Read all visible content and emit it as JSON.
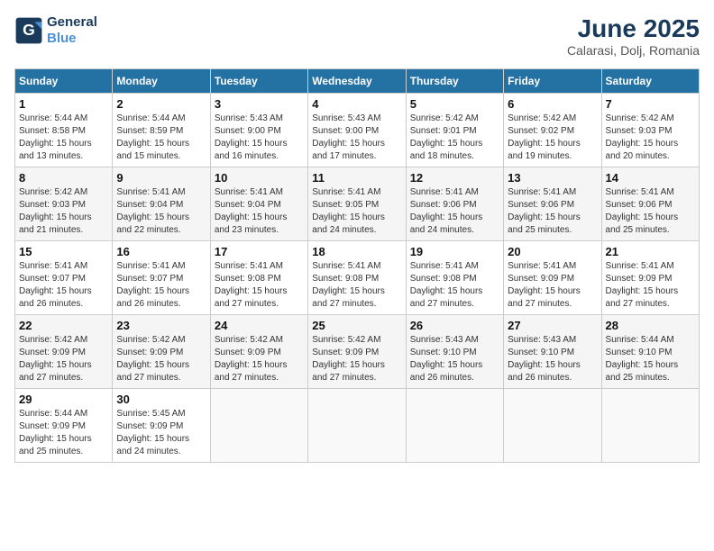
{
  "logo": {
    "line1": "General",
    "line2": "Blue"
  },
  "header": {
    "month_year": "June 2025",
    "location": "Calarasi, Dolj, Romania"
  },
  "days_of_week": [
    "Sunday",
    "Monday",
    "Tuesday",
    "Wednesday",
    "Thursday",
    "Friday",
    "Saturday"
  ],
  "weeks": [
    [
      {
        "day": "1",
        "sunrise": "5:44 AM",
        "sunset": "8:58 PM",
        "daylight": "15 hours and 13 minutes."
      },
      {
        "day": "2",
        "sunrise": "5:44 AM",
        "sunset": "8:59 PM",
        "daylight": "15 hours and 15 minutes."
      },
      {
        "day": "3",
        "sunrise": "5:43 AM",
        "sunset": "9:00 PM",
        "daylight": "15 hours and 16 minutes."
      },
      {
        "day": "4",
        "sunrise": "5:43 AM",
        "sunset": "9:00 PM",
        "daylight": "15 hours and 17 minutes."
      },
      {
        "day": "5",
        "sunrise": "5:42 AM",
        "sunset": "9:01 PM",
        "daylight": "15 hours and 18 minutes."
      },
      {
        "day": "6",
        "sunrise": "5:42 AM",
        "sunset": "9:02 PM",
        "daylight": "15 hours and 19 minutes."
      },
      {
        "day": "7",
        "sunrise": "5:42 AM",
        "sunset": "9:03 PM",
        "daylight": "15 hours and 20 minutes."
      }
    ],
    [
      {
        "day": "8",
        "sunrise": "5:42 AM",
        "sunset": "9:03 PM",
        "daylight": "15 hours and 21 minutes."
      },
      {
        "day": "9",
        "sunrise": "5:41 AM",
        "sunset": "9:04 PM",
        "daylight": "15 hours and 22 minutes."
      },
      {
        "day": "10",
        "sunrise": "5:41 AM",
        "sunset": "9:04 PM",
        "daylight": "15 hours and 23 minutes."
      },
      {
        "day": "11",
        "sunrise": "5:41 AM",
        "sunset": "9:05 PM",
        "daylight": "15 hours and 24 minutes."
      },
      {
        "day": "12",
        "sunrise": "5:41 AM",
        "sunset": "9:06 PM",
        "daylight": "15 hours and 24 minutes."
      },
      {
        "day": "13",
        "sunrise": "5:41 AM",
        "sunset": "9:06 PM",
        "daylight": "15 hours and 25 minutes."
      },
      {
        "day": "14",
        "sunrise": "5:41 AM",
        "sunset": "9:06 PM",
        "daylight": "15 hours and 25 minutes."
      }
    ],
    [
      {
        "day": "15",
        "sunrise": "5:41 AM",
        "sunset": "9:07 PM",
        "daylight": "15 hours and 26 minutes."
      },
      {
        "day": "16",
        "sunrise": "5:41 AM",
        "sunset": "9:07 PM",
        "daylight": "15 hours and 26 minutes."
      },
      {
        "day": "17",
        "sunrise": "5:41 AM",
        "sunset": "9:08 PM",
        "daylight": "15 hours and 27 minutes."
      },
      {
        "day": "18",
        "sunrise": "5:41 AM",
        "sunset": "9:08 PM",
        "daylight": "15 hours and 27 minutes."
      },
      {
        "day": "19",
        "sunrise": "5:41 AM",
        "sunset": "9:08 PM",
        "daylight": "15 hours and 27 minutes."
      },
      {
        "day": "20",
        "sunrise": "5:41 AM",
        "sunset": "9:09 PM",
        "daylight": "15 hours and 27 minutes."
      },
      {
        "day": "21",
        "sunrise": "5:41 AM",
        "sunset": "9:09 PM",
        "daylight": "15 hours and 27 minutes."
      }
    ],
    [
      {
        "day": "22",
        "sunrise": "5:42 AM",
        "sunset": "9:09 PM",
        "daylight": "15 hours and 27 minutes."
      },
      {
        "day": "23",
        "sunrise": "5:42 AM",
        "sunset": "9:09 PM",
        "daylight": "15 hours and 27 minutes."
      },
      {
        "day": "24",
        "sunrise": "5:42 AM",
        "sunset": "9:09 PM",
        "daylight": "15 hours and 27 minutes."
      },
      {
        "day": "25",
        "sunrise": "5:42 AM",
        "sunset": "9:09 PM",
        "daylight": "15 hours and 27 minutes."
      },
      {
        "day": "26",
        "sunrise": "5:43 AM",
        "sunset": "9:10 PM",
        "daylight": "15 hours and 26 minutes."
      },
      {
        "day": "27",
        "sunrise": "5:43 AM",
        "sunset": "9:10 PM",
        "daylight": "15 hours and 26 minutes."
      },
      {
        "day": "28",
        "sunrise": "5:44 AM",
        "sunset": "9:10 PM",
        "daylight": "15 hours and 25 minutes."
      }
    ],
    [
      {
        "day": "29",
        "sunrise": "5:44 AM",
        "sunset": "9:09 PM",
        "daylight": "15 hours and 25 minutes."
      },
      {
        "day": "30",
        "sunrise": "5:45 AM",
        "sunset": "9:09 PM",
        "daylight": "15 hours and 24 minutes."
      },
      null,
      null,
      null,
      null,
      null
    ]
  ]
}
